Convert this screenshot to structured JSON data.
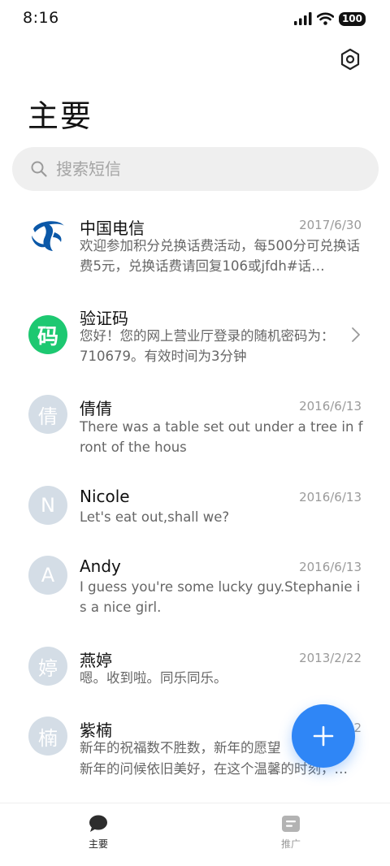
{
  "status_bar": {
    "time": "8:16",
    "battery": "100"
  },
  "page": {
    "title": "主要"
  },
  "search": {
    "placeholder": "搜索短信"
  },
  "conversations": [
    {
      "name": "中国电信",
      "date": "2017/6/30",
      "preview": "欢迎参加积分兑换话费活动，每500分可兑换话费5元，兑换话费请回复106或jfdh#话…",
      "avatar_type": "telecom-logo"
    },
    {
      "name": "验证码",
      "date": "",
      "preview": "您好！您的网上营业厅登录的随机密码为：710679。有效时间为3分钟",
      "avatar_text": "码",
      "avatar_color": "#1dc871"
    },
    {
      "name": "倩倩",
      "date": "2016/6/13",
      "preview": "There was a table set out under a tree in front of the hous",
      "avatar_text": "倩"
    },
    {
      "name": "Nicole",
      "date": "2016/6/13",
      "preview": "Let's eat out,shall we?",
      "avatar_text": "N"
    },
    {
      "name": "Andy",
      "date": "2016/6/13",
      "preview": "I guess you're some lucky guy.Stephanie is a nice girl.",
      "avatar_text": "A"
    },
    {
      "name": "燕婷",
      "date": "2013/2/22",
      "preview": "嗯。收到啦。同乐同乐。",
      "avatar_text": "婷"
    },
    {
      "name": "紫楠",
      "date": "2",
      "preview": "新年的祝福数不胜数，新年的愿望",
      "preview_line2": "新年的问候依旧美好，在这个温馨的时刻，…",
      "avatar_text": "楠"
    }
  ],
  "bottom_nav": [
    {
      "label": "主要",
      "active": true
    },
    {
      "label": "推广",
      "active": false
    }
  ],
  "colors": {
    "accent": "#2f86f6",
    "avatar_gray": "#d4dde6",
    "green": "#1dc871"
  }
}
